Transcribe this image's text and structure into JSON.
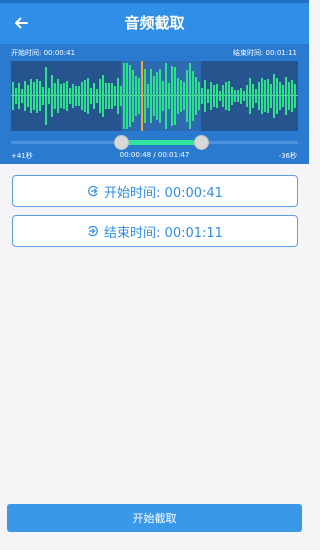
{
  "header": {
    "title": "音频截取"
  },
  "editor": {
    "start_label": "开始时间: 00:00:41",
    "end_label": "结束时间: 00:01:11",
    "left_offset": "+41秒",
    "range_text": "00:00:48 / 00:01:47",
    "right_offset": "-36秒"
  },
  "buttons": {
    "start_time": "开始时间: 00:00:41",
    "end_time": "结束时间: 00:01:11",
    "cut": "开始截取"
  },
  "colors": {
    "accent": "#2f8ee5",
    "waveform": "#2fe08a",
    "playhead": "#f0a63a"
  },
  "icons": {
    "back": "arrow-left-icon",
    "start_time": "clock-in-icon",
    "end_time": "clock-out-icon"
  }
}
